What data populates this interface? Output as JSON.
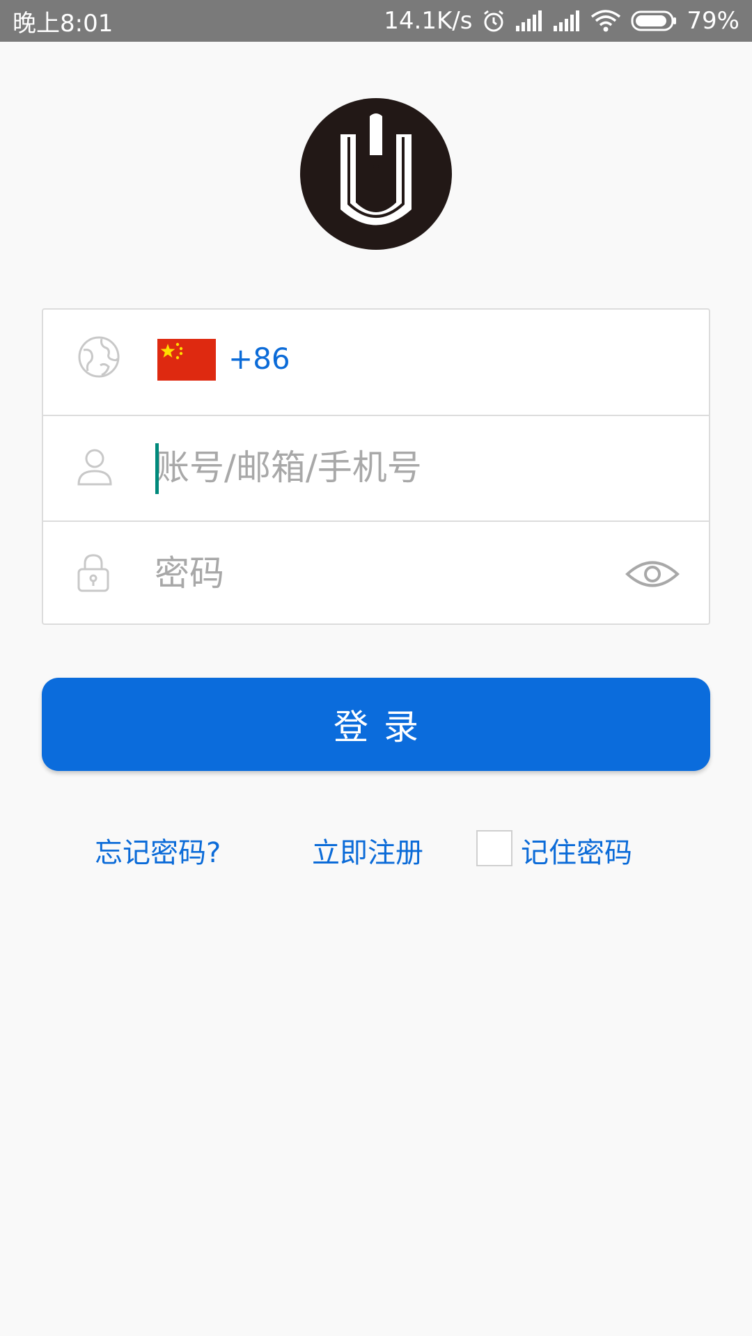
{
  "status_bar": {
    "time": "晚上8:01",
    "net_speed": "14.1K/s",
    "battery": "79%"
  },
  "icons": {
    "logo": "brand-logo-u",
    "country": "globe-icon",
    "account": "user-icon",
    "password": "lock-icon",
    "visibility": "eye-icon",
    "status": [
      "alarm-icon",
      "signal-icon",
      "signal-icon",
      "wifi-icon",
      "battery-icon"
    ]
  },
  "login_form": {
    "country_code": "+86",
    "account_placeholder": "账号/邮箱/手机号",
    "account_value": "",
    "password_placeholder": "密码",
    "password_value": ""
  },
  "actions": {
    "login_label": "登录",
    "forgot_password": "忘记密码?",
    "register": "立即注册",
    "remember_password": "记住密码",
    "remember_checked": false
  },
  "colors": {
    "accent": "#0b6cdc",
    "status_bar": "#7a7a7a",
    "cursor": "#00897b",
    "flag_red": "#de2910",
    "flag_star": "#ffde00"
  }
}
